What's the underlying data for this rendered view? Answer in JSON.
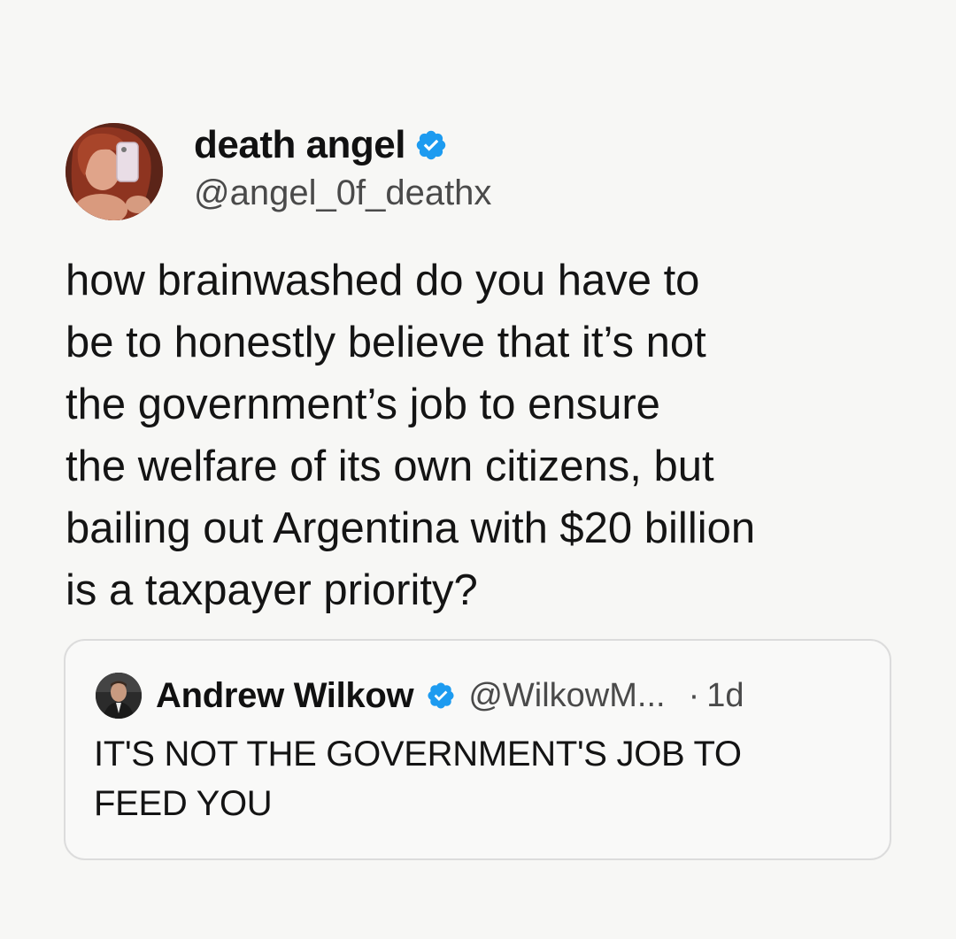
{
  "post": {
    "author": {
      "display_name": "death angel",
      "handle": "@angel_0f_deathx",
      "verified": true
    },
    "body_lines": [
      "how brainwashed do you have to",
      "be to honestly believe that it’s not",
      "the government’s job to ensure",
      "the welfare of its own citizens, but",
      "bailing out Argentina with $20 billion",
      "is a taxpayer priority?"
    ]
  },
  "quoted_post": {
    "author": {
      "display_name": "Andrew Wilkow",
      "handle": "@WilkowM...",
      "verified": true
    },
    "separator": "·",
    "time": "1d",
    "body_lines": [
      "IT'S NOT THE GOVERNMENT'S JOB TO",
      "FEED YOU"
    ]
  },
  "icons": {
    "verified": "verified-badge-icon"
  },
  "colors": {
    "background": "#f7f7f5",
    "verified_blue": "#1d9bf0",
    "text": "#141414",
    "secondary_text": "#4a4a4a",
    "card_border": "#dcdcdc"
  }
}
